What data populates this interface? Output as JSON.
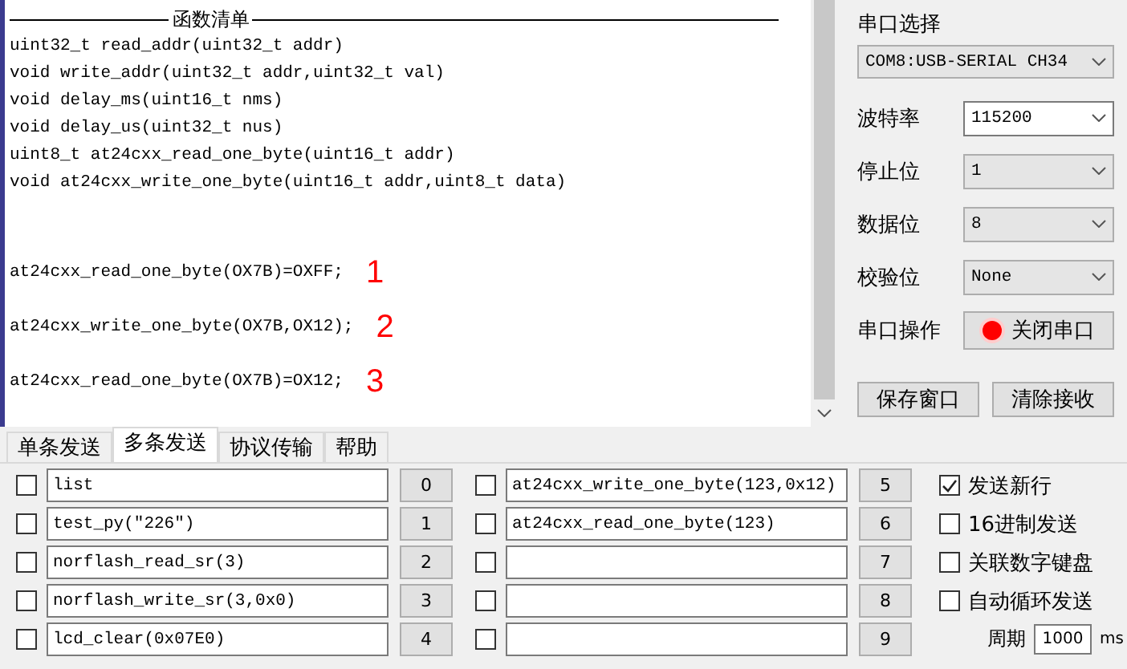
{
  "log": {
    "header": "函数清单",
    "lines": [
      "uint32_t read_addr(uint32_t addr)",
      "void write_addr(uint32_t addr,uint32_t val)",
      "void delay_ms(uint16_t nms)",
      "void delay_us(uint32_t nus)",
      "uint8_t at24cxx_read_one_byte(uint16_t addr)",
      "void at24cxx_write_one_byte(uint16_t addr,uint8_t data)"
    ],
    "results": [
      {
        "text": "at24cxx_read_one_byte(OX7B)=OXFF;",
        "marker": "1"
      },
      {
        "text": "at24cxx_write_one_byte(OX7B,OX12);",
        "marker": "2"
      },
      {
        "text": "at24cxx_read_one_byte(OX7B)=OX12;",
        "marker": "3"
      }
    ]
  },
  "serial": {
    "title": "串口选择",
    "port": "COM8:USB-SERIAL CH34",
    "fields": [
      {
        "label": "波特率",
        "value": "115200",
        "kind": "edit"
      },
      {
        "label": "停止位",
        "value": "1",
        "kind": "select"
      },
      {
        "label": "数据位",
        "value": "8",
        "kind": "select"
      },
      {
        "label": "校验位",
        "value": "None",
        "kind": "select"
      }
    ],
    "operation": {
      "label": "串口操作",
      "button": "关闭串口",
      "open": true
    },
    "buttons": [
      "保存窗口",
      "清除接收"
    ]
  },
  "tabs": [
    {
      "label": "单条发送",
      "selected": false
    },
    {
      "label": "多条发送",
      "selected": true
    },
    {
      "label": "协议传输",
      "selected": false
    },
    {
      "label": "帮助",
      "selected": false
    }
  ],
  "send_rows": [
    {
      "checked": false,
      "text": "list",
      "button": "0"
    },
    {
      "checked": false,
      "text": "test_py(\"226\")",
      "button": "1"
    },
    {
      "checked": false,
      "text": "norflash_read_sr(3)",
      "button": "2"
    },
    {
      "checked": false,
      "text": "norflash_write_sr(3,0x0)",
      "button": "3"
    },
    {
      "checked": false,
      "text": "lcd_clear(0x07E0)",
      "button": "4"
    },
    {
      "checked": false,
      "text": "at24cxx_write_one_byte(123,0x12)",
      "button": "5"
    },
    {
      "checked": false,
      "text": "at24cxx_read_one_byte(123)",
      "button": "6"
    },
    {
      "checked": false,
      "text": "",
      "button": "7"
    },
    {
      "checked": false,
      "text": "",
      "button": "8"
    },
    {
      "checked": false,
      "text": "",
      "button": "9"
    }
  ],
  "options": [
    {
      "label": "发送新行",
      "checked": true
    },
    {
      "label": "16进制发送",
      "checked": false
    },
    {
      "label": "关联数字键盘",
      "checked": false
    },
    {
      "label": "自动循环发送",
      "checked": false
    }
  ],
  "interval": {
    "label": "周期",
    "value": "1000",
    "unit": "ms"
  }
}
